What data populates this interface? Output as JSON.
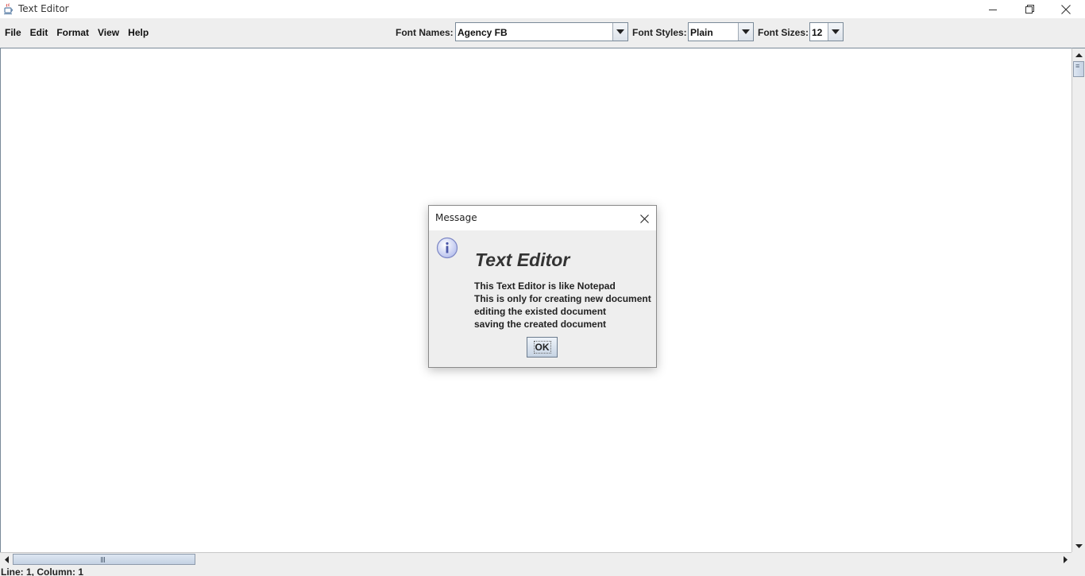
{
  "window": {
    "title": "Text Editor",
    "icon": "java-cup-icon"
  },
  "menubar": {
    "items": [
      {
        "label": "File"
      },
      {
        "label": "Edit"
      },
      {
        "label": "Format"
      },
      {
        "label": "View"
      },
      {
        "label": "Help"
      }
    ]
  },
  "toolbar": {
    "font_names_label": "Font Names:",
    "font_names_value": "Agency FB",
    "font_styles_label": "Font Styles:",
    "font_styles_value": "Plain",
    "font_sizes_label": "Font Sizes:",
    "font_sizes_value": "12"
  },
  "status": {
    "text": "Line: 1, Column: 1"
  },
  "dialog": {
    "title": "Message",
    "icon": "info-icon",
    "heading": "Text Editor",
    "lines": [
      "This Text Editor is like Notepad",
      "This is only for creating new document",
      "editing the existed document",
      "saving the created document"
    ],
    "ok_label": "OK"
  },
  "colors": {
    "chrome": "#eeeeee",
    "border": "#7a8a99",
    "accent": "#c6d3e3"
  }
}
